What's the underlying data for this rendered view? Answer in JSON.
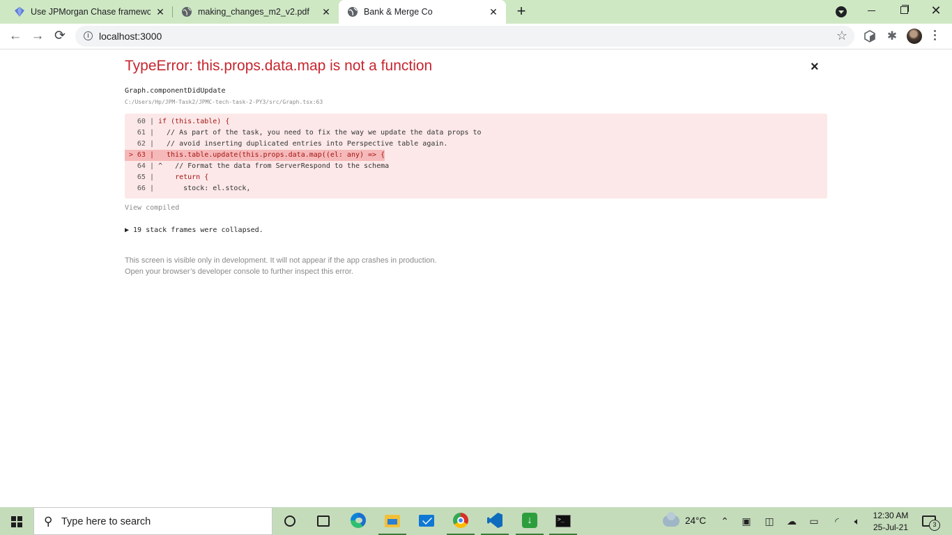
{
  "browser": {
    "tabs": [
      {
        "title": "Use JPMorgan Chase frameworks",
        "icon": "jpmorgan-logo-icon",
        "close": "✕"
      },
      {
        "title": "making_changes_m2_v2.pdf",
        "icon": "globe-icon",
        "close": "✕"
      },
      {
        "title": "Bank & Merge Co",
        "icon": "globe-icon",
        "close": "✕",
        "active": true
      }
    ],
    "new_tab": "+",
    "window_close": "✕",
    "url": "localhost:3000",
    "accent_color": "#cfe8c4"
  },
  "error": {
    "title": "TypeError: this.props.data.map is not a function",
    "close": "×",
    "frame_function": "Graph.componentDidUpdate",
    "frame_path": "C:/Users/Hp/JPM-Task2/JPMC-tech-task-2-PY3/src/Graph.tsx:63",
    "code_lines": [
      {
        "gutter": "  60 | ",
        "code": "if (this.table) {"
      },
      {
        "gutter": "  61 | ",
        "code": "  // As part of the task, you need to fix the way we update the data props to"
      },
      {
        "gutter": "  62 | ",
        "code": "  // avoid inserting duplicated entries into Perspective table again."
      },
      {
        "gutter": "> 63 | ",
        "code": "  this.table.update(this.props.data.map((el: any) => {",
        "highlight": true
      },
      {
        "gutter": "  64 | ",
        "code": "^   // Format the data from ServerRespond to the schema"
      },
      {
        "gutter": "  65 | ",
        "code": "    return {"
      },
      {
        "gutter": "  66 | ",
        "code": "      stock: el.stock,"
      }
    ],
    "view_compiled": "View compiled",
    "collapsed_frames": "▶ 19 stack frames were collapsed.",
    "dev_note_line1": "This screen is visible only in development. It will not appear if the app crashes in production.",
    "dev_note_line2": "Open your browser’s developer console to further inspect this error.",
    "title_color": "#c6262e"
  },
  "taskbar": {
    "search_placeholder": "Type here to search",
    "temperature": "24°C",
    "time": "12:30 AM",
    "date": "25-Jul-21",
    "notification_count": "3"
  }
}
